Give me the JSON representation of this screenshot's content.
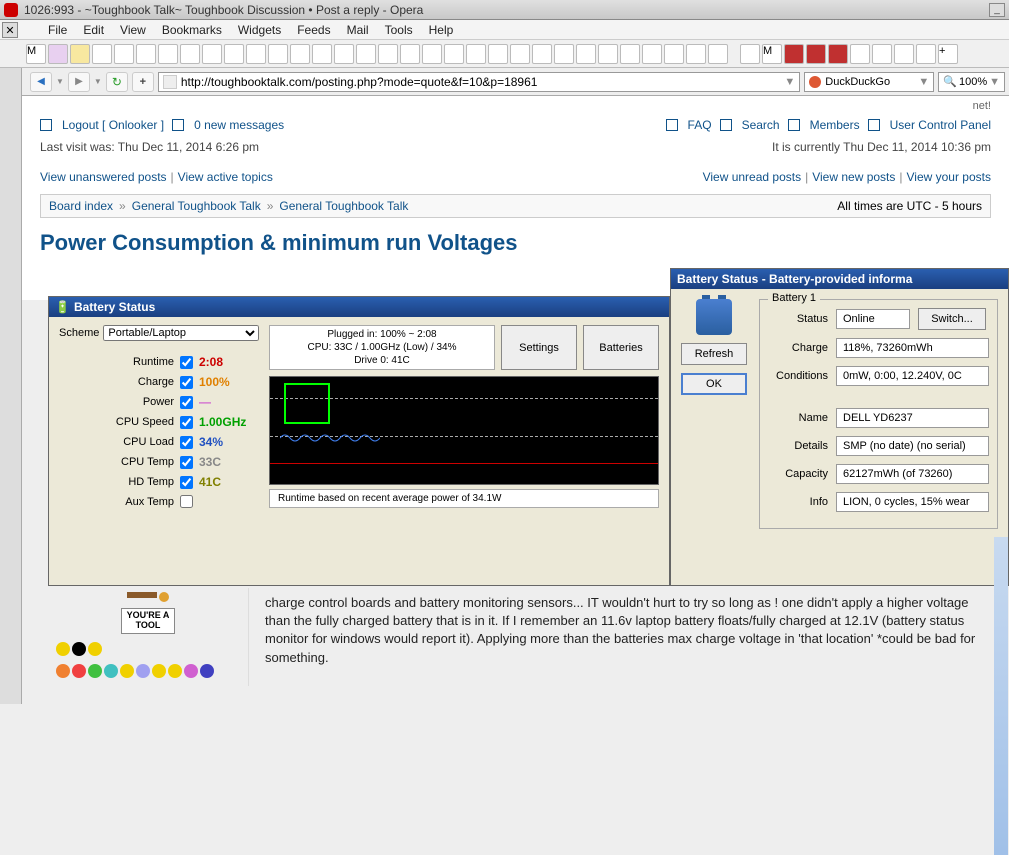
{
  "window": {
    "title": "1026:993 - ~Toughbook Talk~ Toughbook Discussion • Post a reply - Opera"
  },
  "menu": {
    "file": "File",
    "edit": "Edit",
    "view": "View",
    "bookmarks": "Bookmarks",
    "widgets": "Widgets",
    "feeds": "Feeds",
    "mail": "Mail",
    "tools": "Tools",
    "help": "Help"
  },
  "nav": {
    "url": "http://toughbooktalk.com/posting.php?mode=quote&f=10&p=18961",
    "search_engine": "DuckDuckGo",
    "zoom": "100%"
  },
  "page": {
    "top_notice": "net!",
    "logout": "Logout [ Onlooker ]",
    "messages": "0 new messages",
    "faq": "FAQ",
    "search": "Search",
    "members": "Members",
    "ucp": "User Control Panel",
    "last_visit": "Last visit was: Thu Dec 11, 2014 6:26 pm",
    "current_time": "It is currently Thu Dec 11, 2014 10:36 pm",
    "view_unanswered": "View unanswered posts",
    "view_active": "View active topics",
    "view_unread": "View unread posts",
    "view_new": "View new posts",
    "view_your": "View your posts",
    "breadcrumb": {
      "board": "Board index",
      "f1": "General Toughbook Talk",
      "f2": "General Toughbook Talk"
    },
    "times_utc": "All times are UTC - 5 hours",
    "thread_title": "Power Consumption & minimum run Voltages",
    "post_excerpt": "charge control boards and battery monitoring sensors... IT wouldn't hurt to try so long as ! one didn't apply a higher voltage than the fully charged battery that is in it. If I remember an 11.6v laptop battery floats/fully charged at 12.1V (battery status monitor for windows would report it). Applying more than the batteries max charge voltage in 'that location' *could be bad for something.",
    "toolbox": "YOU'RE A TOOL"
  },
  "batt_app": {
    "title": "Battery Status",
    "scheme_label": "Scheme",
    "scheme_value": "Portable/Laptop",
    "rows": {
      "runtime": {
        "label": "Runtime",
        "value": "2:08",
        "color": "#c00"
      },
      "charge": {
        "label": "Charge",
        "value": "100%",
        "color": "#e08000"
      },
      "power": {
        "label": "Power",
        "value": "—",
        "color": "#d060d0"
      },
      "cpuspeed": {
        "label": "CPU Speed",
        "value": "1.00GHz",
        "color": "#00a000"
      },
      "cpuload": {
        "label": "CPU Load",
        "value": "34%",
        "color": "#2050c0"
      },
      "cputemp": {
        "label": "CPU Temp",
        "value": "33C",
        "color": "#888"
      },
      "hdtemp": {
        "label": "HD Temp",
        "value": "41C",
        "color": "#808000"
      },
      "auxtemp": {
        "label": "Aux Temp",
        "value": "",
        "color": "#444"
      }
    },
    "info_line1": "Plugged in: 100% ~ 2:08",
    "info_line2": "CPU: 33C / 1.00GHz (Low) / 34%",
    "info_line3": "Drive 0: 41C",
    "settings_btn": "Settings",
    "batteries_btn": "Batteries",
    "footnote": "Runtime based on recent average power of 34.1W"
  },
  "batt_panel": {
    "title": "Battery Status - Battery-provided informa",
    "refresh": "Refresh",
    "ok": "OK",
    "legend": "Battery 1",
    "switch": "Switch...",
    "fields": {
      "status": {
        "label": "Status",
        "value": "Online"
      },
      "charge": {
        "label": "Charge",
        "value": "118%, 73260mWh"
      },
      "conditions": {
        "label": "Conditions",
        "value": "0mW, 0:00, 12.240V, 0C"
      },
      "name": {
        "label": "Name",
        "value": "DELL YD6237"
      },
      "details": {
        "label": "Details",
        "value": "SMP (no date) (no serial)"
      },
      "capacity": {
        "label": "Capacity",
        "value": "62127mWh (of 73260)"
      },
      "info": {
        "label": "Info",
        "value": "LION, 0 cycles, 15% wear"
      }
    }
  }
}
